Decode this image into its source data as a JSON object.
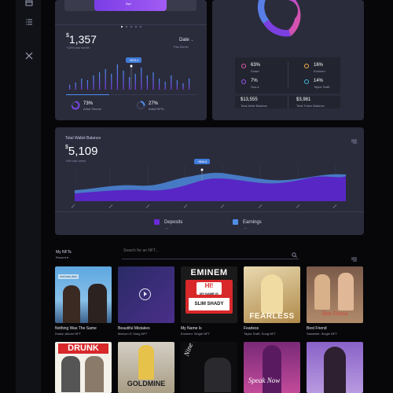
{
  "sidebar": {
    "icons": [
      "window-icon",
      "list-icon",
      "tools-icon"
    ]
  },
  "artist_card": {
    "currency": "$",
    "value": "1,357",
    "change": "+18% last month",
    "date_label": "Date",
    "date_sub": "This Month",
    "tooltip": "+$76.4",
    "stats": [
      {
        "value": "73%",
        "label": "Artist Tokens"
      },
      {
        "value": "27%",
        "label": "Artist NFTs"
      }
    ],
    "top_card_label": "Ayo"
  },
  "donut_card": {
    "legend": [
      {
        "value": "63%",
        "label": "Drake",
        "color": "#e05aa8"
      },
      {
        "value": "16%",
        "label": "Eminem",
        "color": "#f2b04a"
      },
      {
        "value": "7%",
        "label": "Sza-d",
        "color": "#9b58e8"
      },
      {
        "value": "14%",
        "label": "Taylor Swift",
        "color": "#3fb6d8"
      }
    ],
    "totals": [
      {
        "value": "$13,555",
        "label": "Total Artist Balance"
      },
      {
        "value": "$3,981",
        "label": "Total Token Balance"
      }
    ]
  },
  "wallet": {
    "title": "Total Wallet Balance",
    "currency": "$",
    "value": "5,109",
    "change": "+8% last week",
    "tooltip": "+$56.8",
    "legend": [
      {
        "label": "Deposits",
        "color": "#6a2bd8"
      },
      {
        "label": "Earnings",
        "color": "#4f8fe6"
      }
    ]
  },
  "nfts": {
    "title": "My NFTs",
    "sort": "Recent",
    "search_placeholder": "Search for an NFT...",
    "items": [
      {
        "title": "Nothing Was The Same",
        "sub": "Drake: Album NFT",
        "art": "NOTHING WAS THE SAME"
      },
      {
        "title": "Beautiful Mistakes",
        "sub": "Maroon 5: Song NFT",
        "art": ""
      },
      {
        "title": "My Name Is",
        "sub": "Eminem: Single NFT",
        "art": "EMINEM"
      },
      {
        "title": "Fearless",
        "sub": "Taylor Swift: Song NFT",
        "art": "FEARLESS"
      },
      {
        "title": "Best Friend",
        "sub": "Saweetie: Single NFT",
        "art": "Best Friend"
      },
      {
        "title": "",
        "sub": "",
        "art": "DRUNK"
      },
      {
        "title": "",
        "sub": "",
        "art": "GOLDMINE"
      },
      {
        "title": "",
        "sub": "",
        "art": "Nine Lives"
      },
      {
        "title": "",
        "sub": "",
        "art": ""
      },
      {
        "title": "",
        "sub": "",
        "art": "Speak Now"
      },
      {
        "title": "",
        "sub": "",
        "art": ""
      }
    ]
  }
}
